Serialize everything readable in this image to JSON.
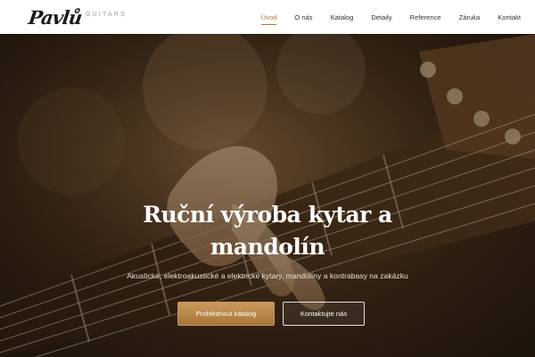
{
  "brand": {
    "logo_text": "Pavlů",
    "tagline": "GUITARS"
  },
  "nav": {
    "items": [
      {
        "label": "Úvod",
        "active": true
      },
      {
        "label": "O nás",
        "active": false
      },
      {
        "label": "Katalog",
        "active": false
      },
      {
        "label": "Detaily",
        "active": false
      },
      {
        "label": "Reference",
        "active": false
      },
      {
        "label": "Záruka",
        "active": false
      },
      {
        "label": "Kontakt",
        "active": false
      }
    ]
  },
  "hero": {
    "title_line1": "Ruční výroba kytar a",
    "title_line2": "mandolín",
    "subtitle": "Akustické, elektroakustické a elektrické kytary, mandolíny a kontrabasy na zakázku",
    "primary_button": "Prohlédnout katalog",
    "secondary_button": "Kontaktujte nás"
  },
  "colors": {
    "accent": "#b07a36",
    "button_gold": "#b8844a",
    "header_bg": "#ffffff"
  }
}
